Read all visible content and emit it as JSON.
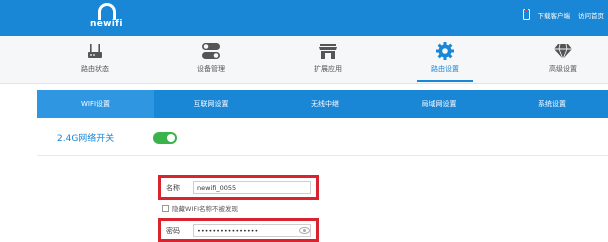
{
  "header": {
    "logo_text": "newifi",
    "links": [
      {
        "label": "下载客户端"
      },
      {
        "label": "访问首页"
      }
    ]
  },
  "nav": {
    "items": [
      {
        "label": "路由状态",
        "icon": "router-icon"
      },
      {
        "label": "设备管理",
        "icon": "devices-toggle-icon"
      },
      {
        "label": "扩展应用",
        "icon": "store-icon"
      },
      {
        "label": "路由设置",
        "icon": "gear-icon",
        "active": true
      },
      {
        "label": "高级设置",
        "icon": "diamond-icon"
      }
    ]
  },
  "subtabs": [
    {
      "label": "WIFI设置",
      "active": true
    },
    {
      "label": "互联网设置"
    },
    {
      "label": "无线中继"
    },
    {
      "label": "局域网设置"
    },
    {
      "label": "系统设置"
    }
  ],
  "wifi": {
    "toggle_label": "2.4G网络开关",
    "toggle_on": true,
    "name_label": "名称",
    "name_value": "newifi_0055",
    "hide_label": "隐藏WIFI名称不被发现",
    "password_label": "密码",
    "password_value": "••••••••••••••••"
  },
  "colors": {
    "primary": "#1a86d6",
    "toggle_on": "#3ab44a",
    "highlight": "#d9232f"
  }
}
